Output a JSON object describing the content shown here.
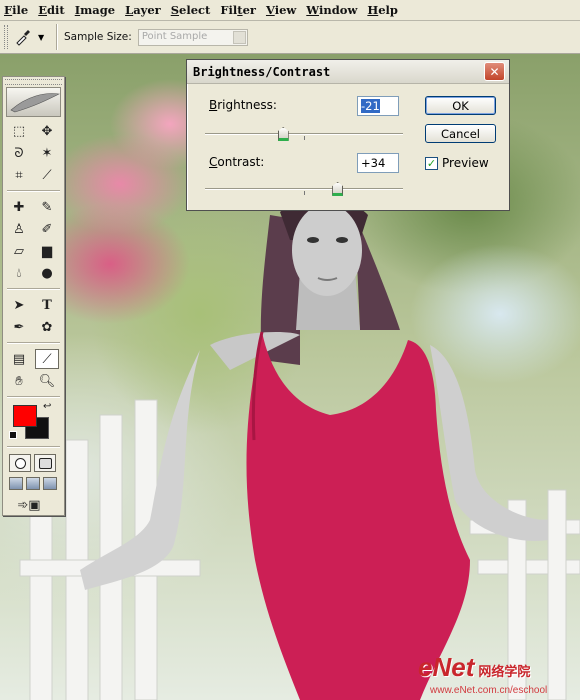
{
  "menu": {
    "items": [
      "File",
      "Edit",
      "Image",
      "Layer",
      "Select",
      "Filter",
      "View",
      "Window",
      "Help"
    ],
    "underline_chars": [
      "F",
      "E",
      "I",
      "L",
      "S",
      "F",
      "V",
      "W",
      "H"
    ]
  },
  "options_bar": {
    "tool_icon": "eyedropper-icon",
    "sample_size_label": "Sample Size:",
    "sample_size_value": "Point Sample"
  },
  "tools_palette": {
    "tools": [
      "rectangular-marquee-icon",
      "move-icon",
      "lasso-icon",
      "magic-wand-icon",
      "crop-icon",
      "slice-icon",
      "healing-brush-icon",
      "brush-icon",
      "clone-stamp-icon",
      "history-brush-icon",
      "eraser-icon",
      "gradient-icon",
      "blur-icon",
      "dodge-icon",
      "path-selection-icon",
      "type-icon",
      "pen-icon",
      "custom-shape-icon",
      "notes-icon",
      "eyedropper-icon",
      "hand-icon",
      "zoom-icon"
    ],
    "active_tool": "eyedropper-icon",
    "foreground_color": "#ff0000",
    "background_color": "#111111"
  },
  "dialog": {
    "title": "Brightness/Contrast",
    "brightness_label": "Brightness:",
    "brightness_value": "-21",
    "brightness_level": -21,
    "contrast_label": "Contrast:",
    "contrast_value": "+34",
    "contrast_level": 34,
    "ok_label": "OK",
    "cancel_label": "Cancel",
    "preview_label": "Preview",
    "preview_checked": true
  },
  "watermark": {
    "logo": "eNet",
    "chinese": "网络学院",
    "url": "www.eNet.com.cn/eschool"
  }
}
